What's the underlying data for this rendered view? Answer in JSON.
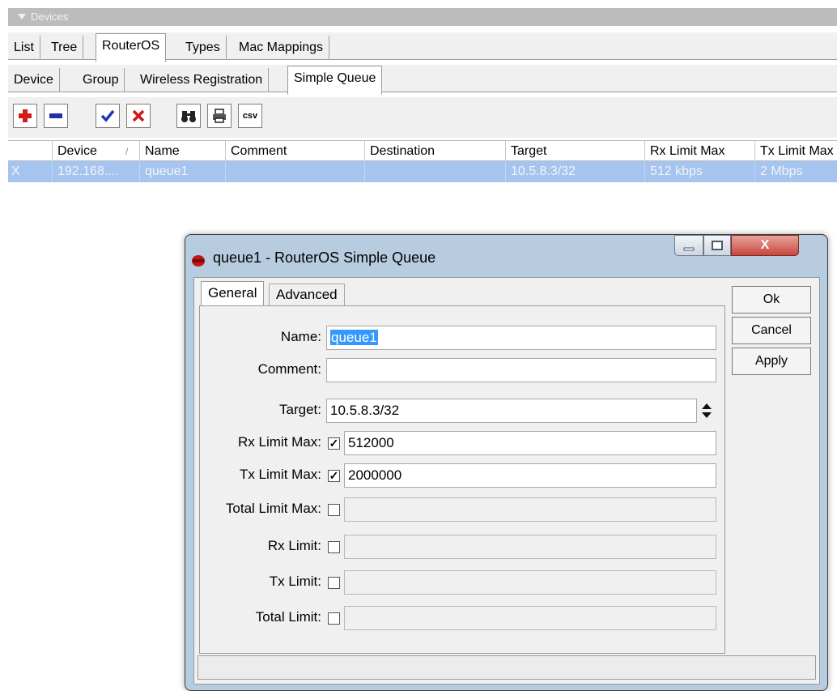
{
  "devices_bar": {
    "title": "Devices"
  },
  "tabs_row1": [
    "List",
    "Tree",
    "RouterOS",
    "Types",
    "Mac Mappings"
  ],
  "tabs_row2": [
    "Device",
    "Group",
    "Wireless Registration",
    "Simple Queue"
  ],
  "toolbar": {
    "add_icon": "plus-icon",
    "remove_icon": "minus-icon",
    "enable_icon": "check-icon",
    "disable_icon": "cross-icon",
    "find_icon": "binoculars-icon",
    "print_icon": "printer-icon",
    "csv_label": "csv"
  },
  "table": {
    "columns": [
      "Device",
      "Name",
      "Comment",
      "Destination",
      "Target",
      "Rx Limit Max",
      "Tx Limit Max"
    ],
    "sort_indicator": "/",
    "rows": [
      {
        "flag": "X",
        "device": "192.168....",
        "name": "queue1",
        "comment": "",
        "destination": "",
        "target": "10.5.8.3/32",
        "rx_limit_max": "512 kbps",
        "tx_limit_max": "2 Mbps"
      }
    ]
  },
  "dialog": {
    "title": "queue1 - RouterOS Simple Queue",
    "tabs": [
      "General",
      "Advanced"
    ],
    "fields": {
      "name_label": "Name:",
      "name_value": "queue1",
      "comment_label": "Comment:",
      "comment_value": "",
      "target_label": "Target:",
      "target_value": "10.5.8.3/32",
      "rx_limit_max_label": "Rx Limit Max:",
      "rx_limit_max_value": "512000",
      "rx_limit_max_checked": true,
      "tx_limit_max_label": "Tx Limit Max:",
      "tx_limit_max_value": "2000000",
      "tx_limit_max_checked": true,
      "total_limit_max_label": "Total Limit Max:",
      "rx_limit_label": "Rx Limit:",
      "tx_limit_label": "Tx Limit:",
      "total_limit_label": "Total Limit:"
    },
    "buttons": {
      "ok": "Ok",
      "cancel": "Cancel",
      "apply": "Apply"
    },
    "close_symbol": "X"
  },
  "colors": {
    "selection_row": "#a5c4ef",
    "close_button": "#c9463d",
    "text_selection": "#3399ff"
  }
}
